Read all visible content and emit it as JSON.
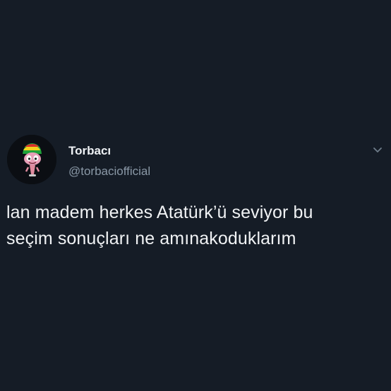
{
  "background_color": "#151c26",
  "author": {
    "display_name": "Torbacı",
    "handle": "@torbaciofficial",
    "avatar_icon": "avatar-image"
  },
  "menu": {
    "icon": "chevron-down-icon"
  },
  "tweet": {
    "lines": [
      "lan madem herkes Atatürk’ü seviyor bu",
      "seçim sonuçları ne amınakoduklarım"
    ]
  },
  "colors": {
    "name": "#eef1f4",
    "handle": "#8a98a6",
    "text": "#f0f2f4",
    "chevron": "#6f7d8a"
  }
}
